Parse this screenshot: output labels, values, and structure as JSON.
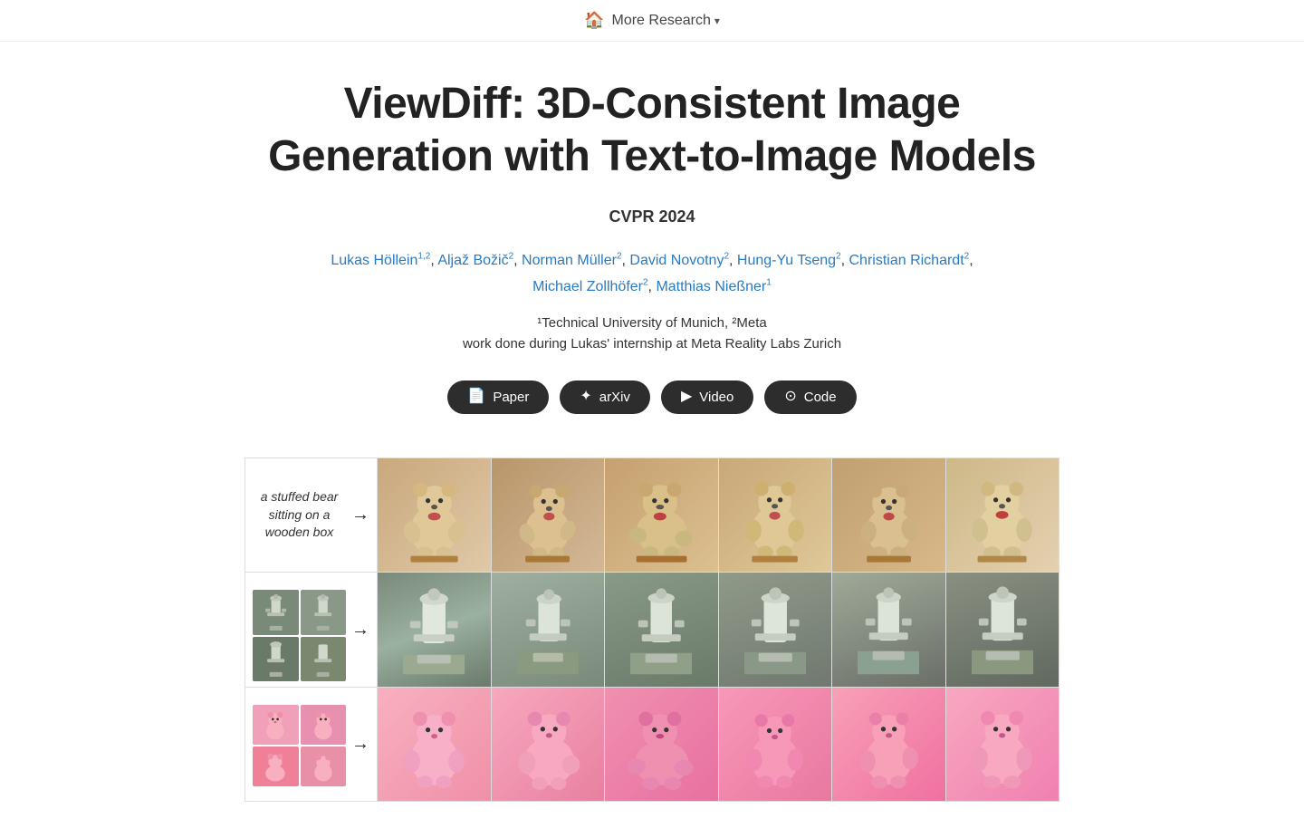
{
  "navbar": {
    "home_icon": "🏠",
    "more_research_label": "More Research",
    "chevron": "▾"
  },
  "paper": {
    "title": "ViewDiff: 3D-Consistent Image Generation with Text-to-Image Models",
    "conference": "CVPR 2024",
    "authors": [
      {
        "name": "Lukas Höllein",
        "superscript": "1,2",
        "link": true
      },
      {
        "name": "Aljaž Božič",
        "superscript": "2",
        "link": true
      },
      {
        "name": "Norman Müller",
        "superscript": "2",
        "link": true
      },
      {
        "name": "David Novotny",
        "superscript": "2",
        "link": true
      },
      {
        "name": "Hung-Yu Tseng",
        "superscript": "2",
        "link": true
      },
      {
        "name": "Christian Richardt",
        "superscript": "2",
        "link": true
      },
      {
        "name": "Michael Zollhöfer",
        "superscript": "2",
        "link": true
      },
      {
        "name": "Matthias Nießner",
        "superscript": "1",
        "link": true
      }
    ],
    "affiliations": "¹Technical University of Munich, ²Meta",
    "internship_note": "work done during Lukas' internship at Meta Reality Labs Zurich",
    "buttons": [
      {
        "label": "Paper",
        "icon": "📄",
        "id": "paper"
      },
      {
        "label": "arXiv",
        "icon": "✦",
        "id": "arxiv"
      },
      {
        "label": "Video",
        "icon": "▶",
        "id": "video"
      },
      {
        "label": "Code",
        "icon": "⊙",
        "id": "code"
      }
    ]
  },
  "demo": {
    "rows": [
      {
        "label": "a stuffed bear sitting on a wooden box",
        "color_scheme": "beige"
      },
      {
        "label": "",
        "color_scheme": "gray"
      },
      {
        "label": "",
        "color_scheme": "pink"
      }
    ]
  }
}
